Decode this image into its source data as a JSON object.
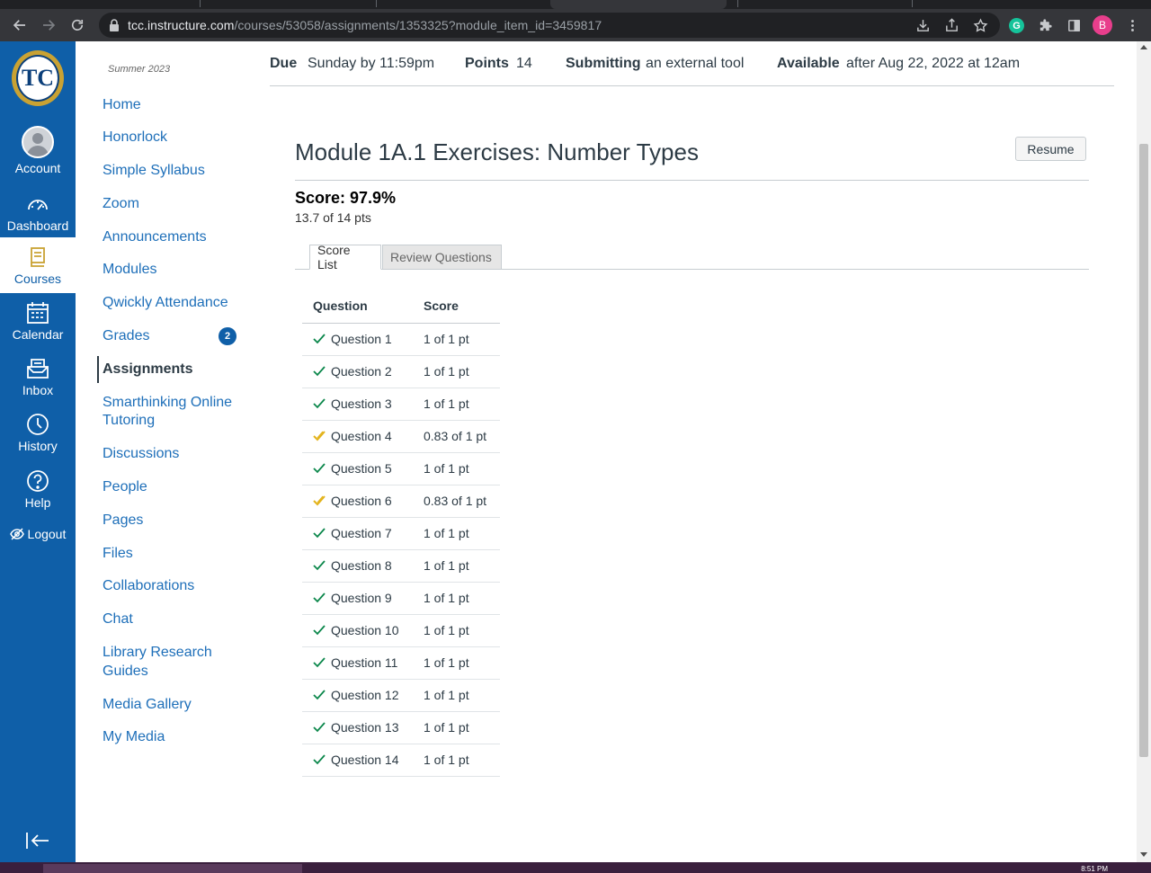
{
  "browser": {
    "url_host": "tcc.instructure.com",
    "url_path": "/courses/53058/assignments/1353325?module_item_id=3459817",
    "profile_initial": "B",
    "grammarly_letter": "G"
  },
  "global_nav": {
    "account": "Account",
    "dashboard": "Dashboard",
    "courses": "Courses",
    "calendar": "Calendar",
    "inbox": "Inbox",
    "history": "History",
    "help": "Help",
    "logout": "Logout",
    "logo_letters": "TC"
  },
  "course_nav": {
    "term": "Summer 2023",
    "items": [
      {
        "label": "Home"
      },
      {
        "label": "Honorlock"
      },
      {
        "label": "Simple Syllabus"
      },
      {
        "label": "Zoom"
      },
      {
        "label": "Announcements"
      },
      {
        "label": "Modules"
      },
      {
        "label": "Qwickly Attendance"
      },
      {
        "label": "Grades"
      },
      {
        "label": "Assignments"
      },
      {
        "label": "Smarthinking Online"
      },
      {
        "label": "Tutoring"
      },
      {
        "label": "Discussions"
      },
      {
        "label": "People"
      },
      {
        "label": "Pages"
      },
      {
        "label": "Files"
      },
      {
        "label": "Collaborations"
      },
      {
        "label": "Chat"
      },
      {
        "label": "Library Research"
      },
      {
        "label": "Guides"
      },
      {
        "label": "Media Gallery"
      },
      {
        "label": "My Media"
      }
    ],
    "grades_badge": "2"
  },
  "assignment": {
    "due_label": "Due",
    "due_value": "Sunday by 11:59pm",
    "points_label": "Points",
    "points_value": "14",
    "submitting_label": "Submitting",
    "submitting_value": "an external tool",
    "available_label": "Available",
    "available_value": "after Aug 22, 2022 at 12am",
    "title": "Module 1A.1 Exercises: Number Types",
    "resume_label": "Resume",
    "score": "Score: 97.9%",
    "score_pts": "13.7 of 14 pts",
    "tab_score_list": "Score List",
    "tab_review": "Review Questions",
    "col_question": "Question",
    "col_score": "Score",
    "rows": [
      {
        "q": "Question 1",
        "s": "1 of 1 pt",
        "partial": false
      },
      {
        "q": "Question 2",
        "s": "1 of 1 pt",
        "partial": false
      },
      {
        "q": "Question 3",
        "s": "1 of 1 pt",
        "partial": false
      },
      {
        "q": "Question 4",
        "s": "0.83 of 1 pt",
        "partial": true
      },
      {
        "q": "Question 5",
        "s": "1 of 1 pt",
        "partial": false
      },
      {
        "q": "Question 6",
        "s": "0.83 of 1 pt",
        "partial": true
      },
      {
        "q": "Question 7",
        "s": "1 of 1 pt",
        "partial": false
      },
      {
        "q": "Question 8",
        "s": "1 of 1 pt",
        "partial": false
      },
      {
        "q": "Question 9",
        "s": "1 of 1 pt",
        "partial": false
      },
      {
        "q": "Question 10",
        "s": "1 of 1 pt",
        "partial": false
      },
      {
        "q": "Question 11",
        "s": "1 of 1 pt",
        "partial": false
      },
      {
        "q": "Question 12",
        "s": "1 of 1 pt",
        "partial": false
      },
      {
        "q": "Question 13",
        "s": "1 of 1 pt",
        "partial": false
      },
      {
        "q": "Question 14",
        "s": "1 of 1 pt",
        "partial": false
      }
    ]
  },
  "taskbar": {
    "clock": "8:51 PM"
  },
  "colors": {
    "nav_blue": "#0f5fa8",
    "link_blue": "#1e6fb9",
    "check_green": "#0b874b",
    "check_partial": "#e3b31b"
  },
  "icons": {
    "check": "check-icon",
    "partial_check": "partial-check-icon"
  }
}
